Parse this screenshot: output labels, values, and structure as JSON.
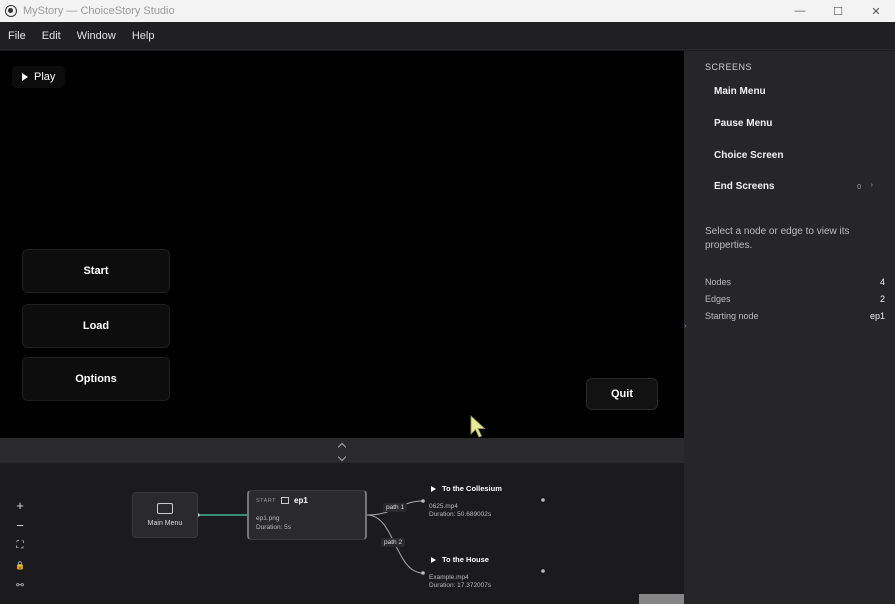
{
  "window": {
    "title": "MyStory — ChoiceStory Studio",
    "controls": [
      "—",
      "☐",
      "✕"
    ]
  },
  "menubar": [
    "File",
    "Edit",
    "Window",
    "Help"
  ],
  "preview": {
    "play_label": "Play",
    "buttons": {
      "start": "Start",
      "load": "Load",
      "options": "Options",
      "quit": "Quit"
    }
  },
  "graph": {
    "tools": [
      "+",
      "−",
      "⛶",
      "🔒",
      "⚯"
    ],
    "nodes": {
      "main_menu": {
        "label": "Main Menu"
      },
      "ep1": {
        "tag": "START",
        "name": "ep1",
        "file": "ep1.png",
        "duration": "Duration: 5s"
      },
      "choice1": {
        "title": "To the Collesium",
        "file": "0625.mp4",
        "duration": "Duration: 50.689002s"
      },
      "choice2": {
        "title": "To the House",
        "file": "Example.mp4",
        "duration": "Duration: 17.372007s"
      }
    },
    "edges": [
      "path 1",
      "path 2"
    ]
  },
  "panel": {
    "heading": "SCREENS",
    "screens": [
      "Main Menu",
      "Pause Menu",
      "Choice Screen",
      "End Screens"
    ],
    "end_screens_count": "0",
    "hint": "Select a node or edge to view its properties.",
    "stats": [
      {
        "label": "Nodes",
        "value": "4"
      },
      {
        "label": "Edges",
        "value": "2"
      },
      {
        "label": "Starting node",
        "value": "ep1"
      }
    ]
  },
  "colors": {
    "accent_edge": "#3fb58f",
    "cursor": "#e8e79a"
  }
}
